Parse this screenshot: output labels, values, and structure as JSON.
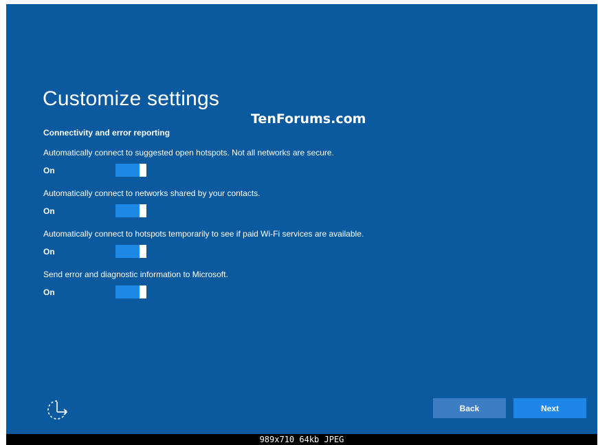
{
  "page": {
    "title": "Customize settings",
    "watermark": "TenForums.com"
  },
  "section": {
    "heading": "Connectivity and error reporting"
  },
  "settings": [
    {
      "description": "Automatically connect to suggested open hotspots. Not all networks are secure.",
      "state": "On"
    },
    {
      "description": "Automatically connect to networks shared by your contacts.",
      "state": "On"
    },
    {
      "description": "Automatically connect to hotspots temporarily to see if paid Wi-Fi services are available.",
      "state": "On"
    },
    {
      "description": "Send error and diagnostic information to Microsoft.",
      "state": "On"
    }
  ],
  "buttons": {
    "back": "Back",
    "next": "Next"
  },
  "icons": {
    "ease_of_access": "ease-of-access-icon"
  },
  "footer": {
    "caption": "989x710  64kb  JPEG"
  },
  "colors": {
    "background": "#0b5aa0",
    "toggle_on": "#1e88e5",
    "back_button": "#3d7dc3",
    "next_button": "#1d86e8"
  }
}
